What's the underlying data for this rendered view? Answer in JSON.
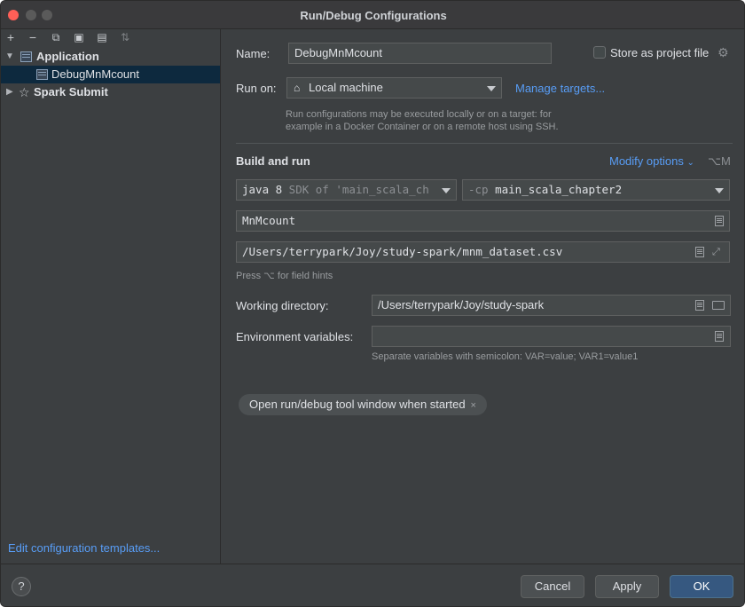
{
  "window": {
    "title": "Run/Debug Configurations"
  },
  "toolbar": {
    "icons": [
      "add-icon",
      "remove-icon",
      "copy-icon",
      "save-icon",
      "new-folder-icon",
      "sort-icon"
    ],
    "glyphs": {
      "add": "+",
      "remove": "−",
      "copy": "⧉",
      "save": "▣",
      "folder": "▤",
      "sort": "⇅"
    }
  },
  "tree": {
    "items": [
      {
        "label": "Application",
        "expanded": true,
        "bold": true
      },
      {
        "label": "DebugMnMcount",
        "selected": true
      },
      {
        "label": "Spark Submit",
        "expanded": false,
        "bold": true
      }
    ]
  },
  "sidebar": {
    "edit_templates": "Edit configuration templates..."
  },
  "form": {
    "name_label": "Name:",
    "name_value": "DebugMnMcount",
    "store_label": "Store as project file",
    "run_on_label": "Run on:",
    "run_on_value": "Local machine",
    "manage_targets": "Manage targets...",
    "run_on_hint_1": "Run configurations may be executed locally or on a target: for",
    "run_on_hint_2": "example in a Docker Container or on a remote host using SSH.",
    "build_and_run": "Build and run",
    "modify_options": "Modify options",
    "modify_shortcut": "⌥M",
    "jdk_main": "java 8",
    "jdk_rest": " SDK of 'main_scala_ch",
    "cp_prefix": "-cp ",
    "cp_value": "main_scala_chapter2",
    "main_class": "MnMcount",
    "program_args": "/Users/terrypark/Joy/study-spark/mnm_dataset.csv",
    "field_hints": "Press ⌥ for field hints",
    "working_dir_label": "Working directory:",
    "working_dir_value": "/Users/terrypark/Joy/study-spark",
    "env_label": "Environment variables:",
    "env_value": "",
    "env_hint": "Separate variables with semicolon: VAR=value; VAR1=value1",
    "chip_label": "Open run/debug tool window when started",
    "chip_close": "×"
  },
  "footer": {
    "help": "?",
    "cancel": "Cancel",
    "apply": "Apply",
    "ok": "OK"
  },
  "colors": {
    "accent": "#589df6",
    "primary_button": "#365880",
    "selection": "#0d293e"
  }
}
